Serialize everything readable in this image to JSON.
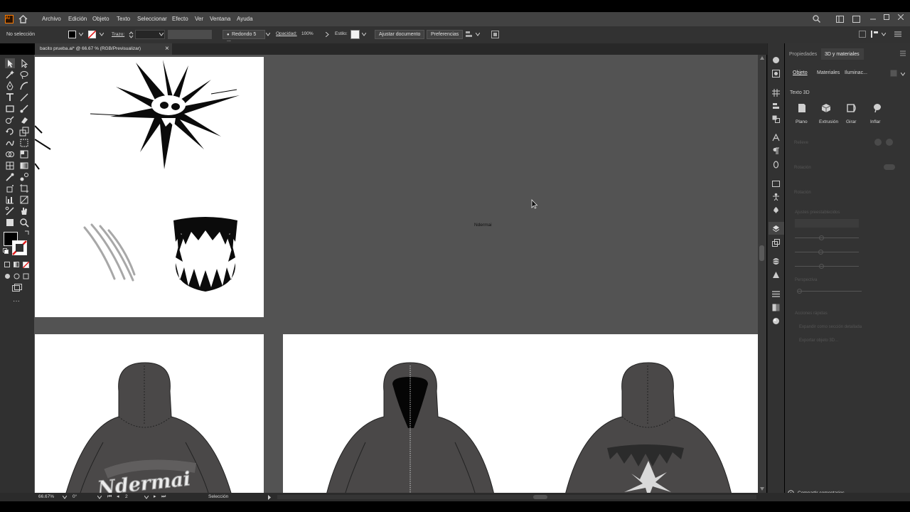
{
  "menubar": {
    "app_badge": "Ai",
    "items": [
      "Archivo",
      "Edición",
      "Objeto",
      "Texto",
      "Seleccionar",
      "Efecto",
      "Ver",
      "Ventana",
      "Ayuda"
    ]
  },
  "controlbar": {
    "selection_label": "No selección",
    "stroke_label": "Trazo:",
    "brush_label": "Redondo 5 ...",
    "opacity_label": "Opacidad:",
    "opacity_value": "100%",
    "style_label": "Estilo:",
    "fit_document_button": "Ajustar documento",
    "preferences_button": "Preferencias"
  },
  "document": {
    "tab_title": "bacito prueba.ai* @ 66.67 % (RGB/Previsualizar)",
    "close_glyph": "×",
    "canvas_label": "Ndermai",
    "hoodie_text": "Ndermai"
  },
  "panel": {
    "tabs": [
      "Propiedades",
      "3D y materiales"
    ],
    "subtabs": [
      "Objeto",
      "Materiales",
      "Iluminac..."
    ],
    "section_title": "Texto 3D",
    "types": [
      "Plano",
      "Extrusión",
      "Girar",
      "Inflar"
    ],
    "disabled_rows": [
      "Relieve",
      "Rotación",
      "Rotación",
      "Ajustes preestablecidos",
      "Perspectiva",
      "Acciones rápidas",
      "Expandir como sección detallada",
      "Exportar objeto 3D..."
    ],
    "share_label": "Compartir comentarios"
  },
  "statusbar": {
    "zoom": "66.67%",
    "rotation": "0°",
    "artboard_number": "2",
    "tool_name": "Selección"
  },
  "colors": {
    "accent": "#e1e1e1",
    "hoodie": "#4a4848",
    "canvas": "#535353",
    "artboard": "#ffffff"
  }
}
